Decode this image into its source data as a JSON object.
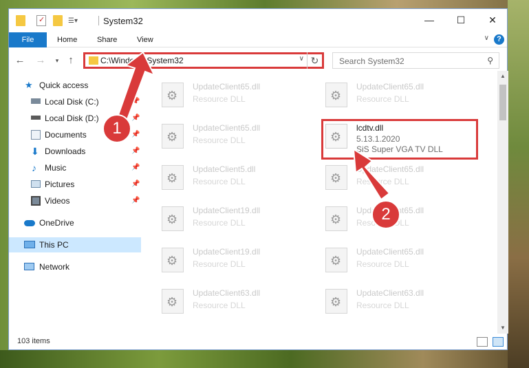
{
  "window": {
    "title": "System32",
    "controls": {
      "minimize": "—",
      "maximize": "☐",
      "close": "✕"
    }
  },
  "ribbon": {
    "tabs": [
      "File",
      "Home",
      "Share",
      "View"
    ],
    "help": "?"
  },
  "address": {
    "path": "C:\\Windows\\System32",
    "search_placeholder": "Search System32"
  },
  "sidebar": {
    "items": [
      {
        "label": "Quick access",
        "icon": "star-icon"
      },
      {
        "label": "Local Disk (C:)",
        "icon": "drive-icon",
        "pinned": true
      },
      {
        "label": "Local Disk (D:)",
        "icon": "drive-icon",
        "pinned": true
      },
      {
        "label": "Documents",
        "icon": "documents-icon",
        "pinned": true
      },
      {
        "label": "Downloads",
        "icon": "download-icon",
        "pinned": true
      },
      {
        "label": "Music",
        "icon": "music-icon",
        "pinned": true
      },
      {
        "label": "Pictures",
        "icon": "pictures-icon",
        "pinned": true
      },
      {
        "label": "Videos",
        "icon": "videos-icon",
        "pinned": true
      },
      {
        "label": "OneDrive",
        "icon": "cloud-icon"
      },
      {
        "label": "This PC",
        "icon": "computer-icon",
        "selected": true
      },
      {
        "label": "Network",
        "icon": "network-icon"
      }
    ]
  },
  "files": {
    "left_column": [
      {
        "name": "UpdateClient65.dll",
        "type": "Resource DLL"
      },
      {
        "name": "UpdateClient65.dll",
        "type": "Resource DLL"
      },
      {
        "name": "UpdateClient5.dll",
        "type": "Resource DLL"
      },
      {
        "name": "UpdateClient19.dll",
        "type": "Resource DLL"
      },
      {
        "name": "UpdateClient19.dll",
        "type": "Resource DLL"
      },
      {
        "name": "UpdateClient63.dll",
        "type": "Resource DLL"
      }
    ],
    "right_column": [
      {
        "name": "UpdateClient65.dll",
        "type": "Resource DLL"
      },
      {
        "name": "UpdateClient65.dll",
        "type": "Resource DLL"
      },
      {
        "name": "UpdateClient65.dll",
        "type": "Resource DLL"
      },
      {
        "name": "UpdateClient65.dll",
        "type": "Resource DLL"
      },
      {
        "name": "UpdateClient63.dll",
        "type": "Resource DLL"
      }
    ],
    "highlighted": {
      "name": "lcdtv.dll",
      "version": "5.13.1.2020",
      "description": "SiS Super VGA TV DLL"
    }
  },
  "status": {
    "item_count": "103 items"
  },
  "callouts": {
    "step1": "1",
    "step2": "2",
    "color": "#d93a3a"
  }
}
